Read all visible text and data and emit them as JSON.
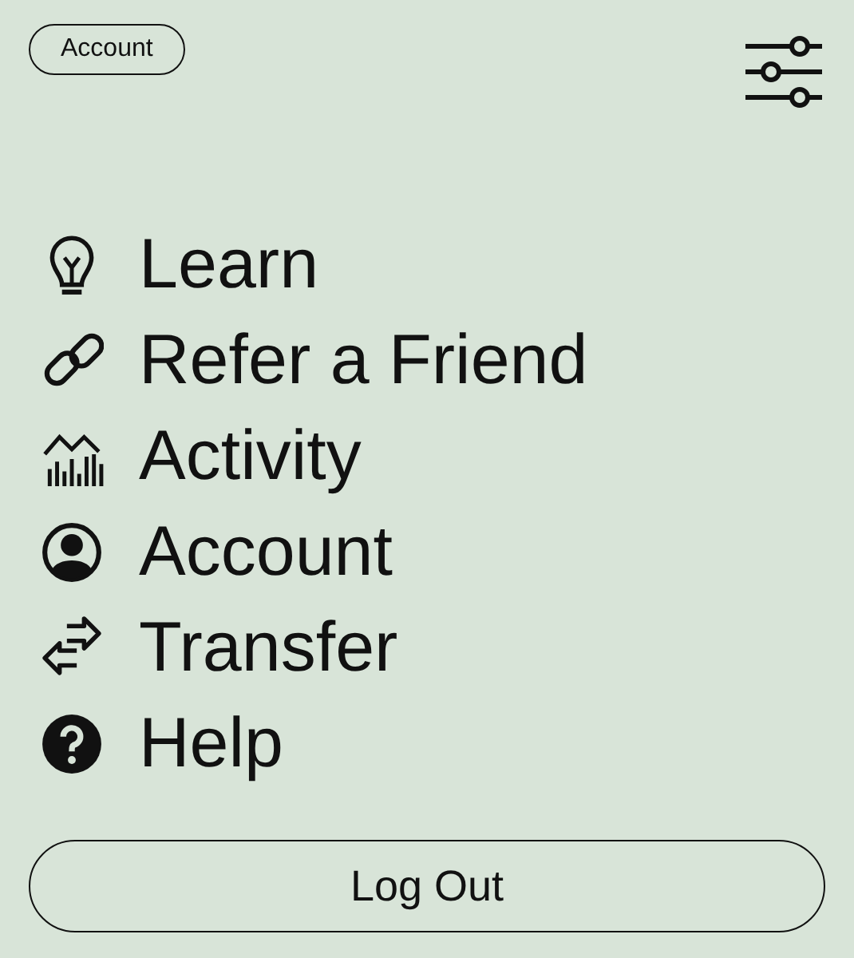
{
  "header": {
    "account_chip": "Account"
  },
  "menu": [
    {
      "kind": "learn",
      "label": "Learn"
    },
    {
      "kind": "refer",
      "label": "Refer a Friend"
    },
    {
      "kind": "activity",
      "label": "Activity"
    },
    {
      "kind": "account",
      "label": "Account"
    },
    {
      "kind": "transfer",
      "label": "Transfer"
    },
    {
      "kind": "help",
      "label": "Help"
    }
  ],
  "logout_button": "Log Out"
}
